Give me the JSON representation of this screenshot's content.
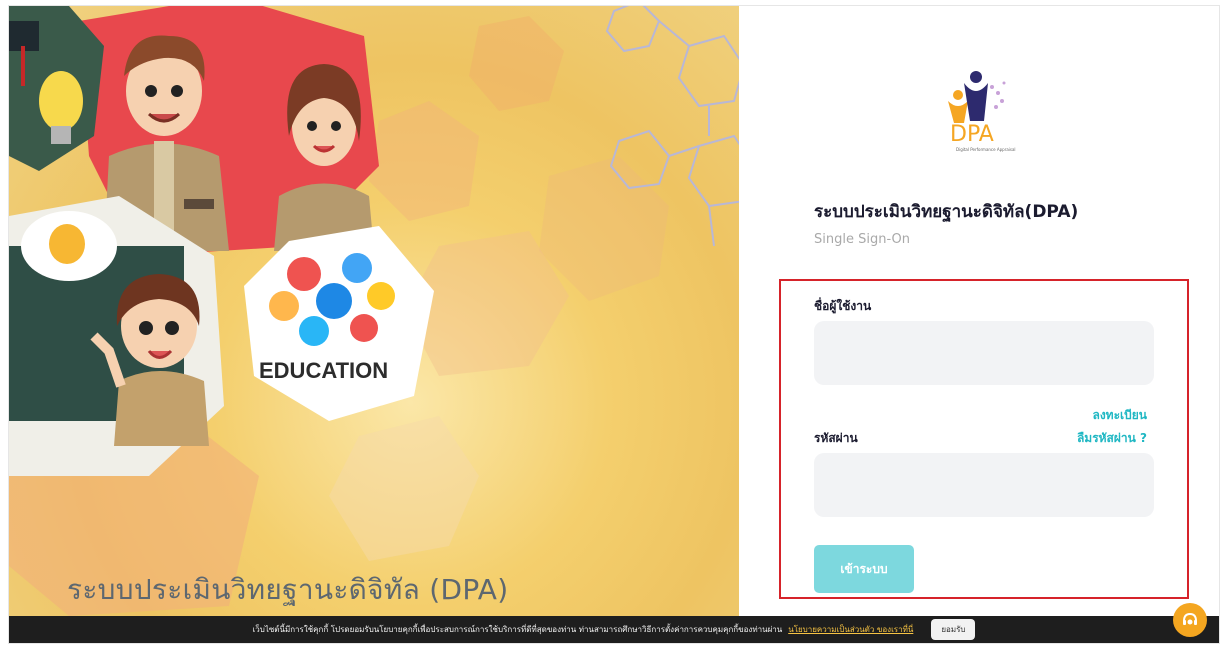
{
  "hero": {
    "title": "ระบบประเมินวิทยฐานะดิจิทัล (DPA)",
    "badge_text": "EDUCATION"
  },
  "logo": {
    "name": "DPA"
  },
  "panel": {
    "title": "ระบบประเมินวิทยฐานะดิจิทัล(DPA)",
    "subtitle": "Single Sign-On"
  },
  "form": {
    "username_label": "ชื่อผู้ใช้งาน",
    "username_value": "",
    "register_link": "ลงทะเบียน",
    "password_label": "รหัสผ่าน",
    "forgot_link": "ลืมรหัสผ่าน ?",
    "password_value": "",
    "login_button": "เข้าระบบ"
  },
  "cookie": {
    "message": "เว็บไซต์นี้มีการใช้คุกกี้ โปรดยอมรับนโยบายคุกกี้เพื่อประสบการณ์การใช้บริการที่ดีที่สุดของท่าน ท่านสามารถศึกษาวิธีการตั้งค่าการควบคุมคุกกี้ของท่านผ่าน",
    "policy_link": "นโยบายความเป็นส่วนตัว ของเราที่นี่",
    "accept_button": "ยอมรับ"
  },
  "colors": {
    "accent": "#1fb7c3",
    "button": "#7dd8de",
    "highlight_border": "#d6232a",
    "help": "#f4a620"
  },
  "icons": {
    "help": "support-headset-icon"
  }
}
